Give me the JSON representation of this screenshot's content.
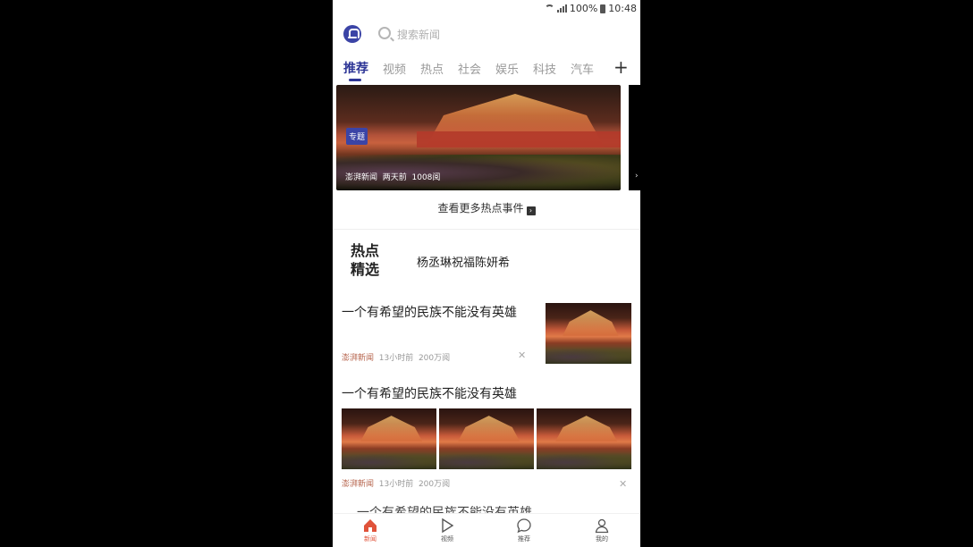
{
  "status_bar": {
    "battery": "100%",
    "time": "10:48"
  },
  "search": {
    "placeholder": "搜索新闻"
  },
  "tabs": [
    {
      "label": "推荐",
      "active": true
    },
    {
      "label": "视频"
    },
    {
      "label": "热点"
    },
    {
      "label": "社会"
    },
    {
      "label": "娱乐"
    },
    {
      "label": "科技"
    },
    {
      "label": "汽车"
    }
  ],
  "tab_add_label": "+",
  "banner": {
    "badge": "专题",
    "source": "澎湃新闻",
    "time": "两天前",
    "reads": "1008阅"
  },
  "more_hot_label": "查看更多热点事件",
  "hot_picks": {
    "title": "热点精选",
    "item": "杨丞琳祝福陈妍希"
  },
  "articles": [
    {
      "title": "一个有希望的民族不能没有英雄",
      "source": "澎湃新闻",
      "time": "13小时前",
      "reads": "200万阅"
    },
    {
      "title": "一个有希望的民族不能没有英雄",
      "source": "澎湃新闻",
      "time": "13小时前",
      "reads": "200万阅"
    },
    {
      "title": "一个有希望的民族不能没有英雄"
    }
  ],
  "bottom_nav": [
    {
      "label": "新闻",
      "icon": "home-icon",
      "active": true
    },
    {
      "label": "视频",
      "icon": "play-icon"
    },
    {
      "label": "推荐",
      "icon": "chat-bubble-icon"
    },
    {
      "label": "我的",
      "icon": "person-icon"
    }
  ],
  "colors": {
    "accent": "#2d3596",
    "nav_active": "#e0533a",
    "source_text": "#b5624a"
  }
}
